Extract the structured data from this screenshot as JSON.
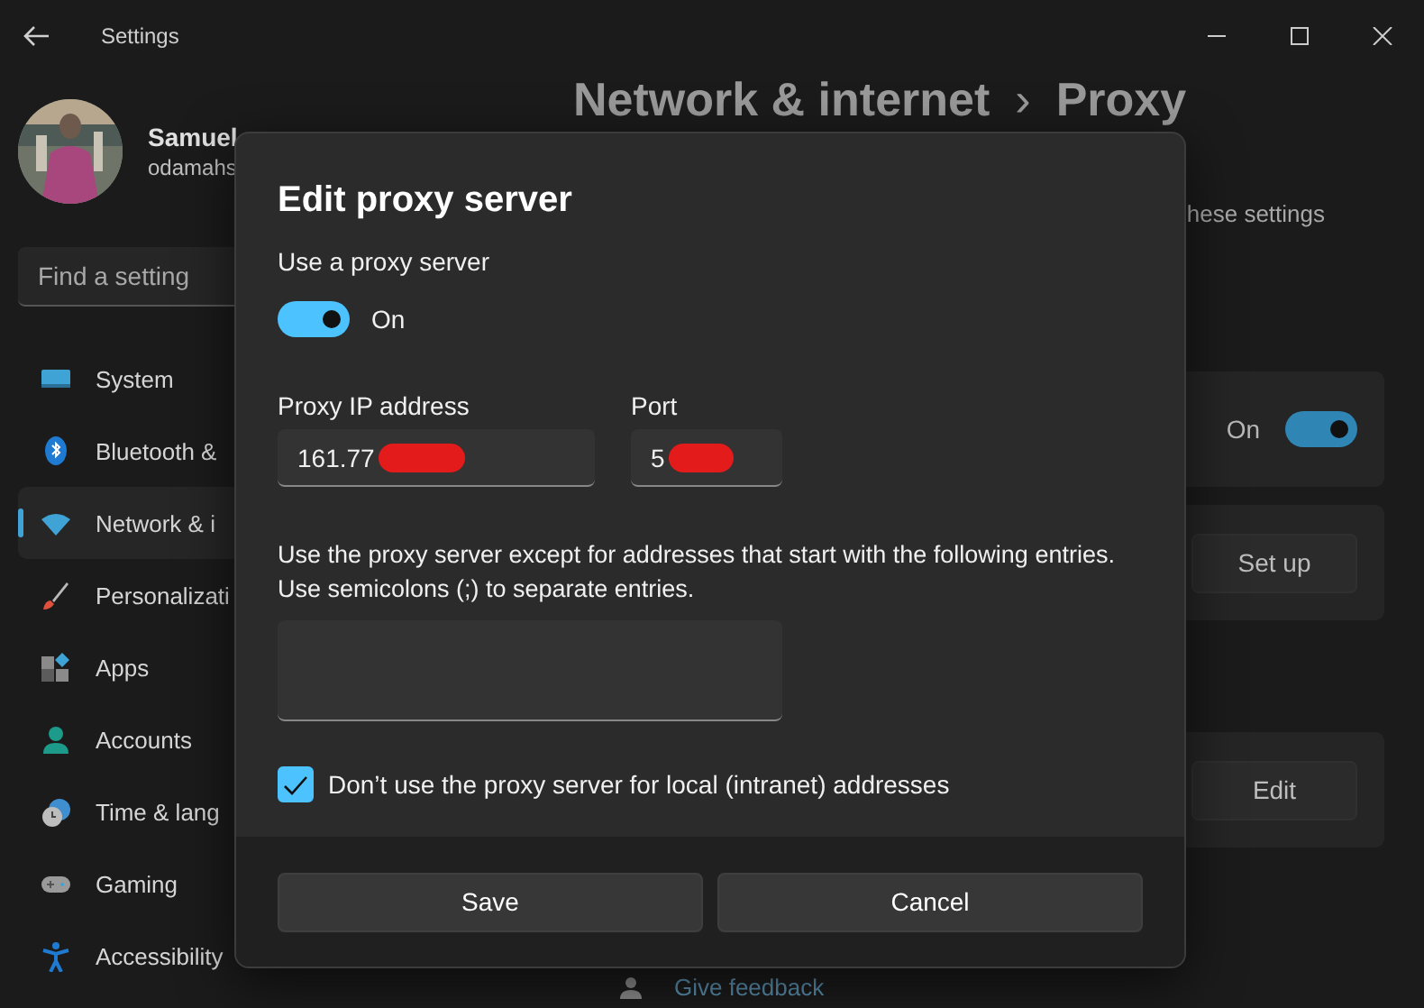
{
  "window": {
    "title": "Settings"
  },
  "profile": {
    "name": "Samuel",
    "email": "odamahs"
  },
  "search": {
    "placeholder": "Find a setting"
  },
  "nav": [
    {
      "label": "System",
      "selected": false
    },
    {
      "label": "Bluetooth &",
      "selected": false
    },
    {
      "label": "Network & i",
      "selected": true
    },
    {
      "label": "Personalizati",
      "selected": false
    },
    {
      "label": "Apps",
      "selected": false
    },
    {
      "label": "Accounts",
      "selected": false
    },
    {
      "label": "Time & lang",
      "selected": false
    },
    {
      "label": "Gaming",
      "selected": false
    },
    {
      "label": "Accessibility",
      "selected": false
    }
  ],
  "page": {
    "breadcrumb": "Network & internet",
    "separator": "›",
    "title": "Proxy",
    "hint": "hese settings"
  },
  "automatic_rows": [
    {
      "kind": "toggle",
      "state_label": "On",
      "on": true
    },
    {
      "kind": "button",
      "button": "Set up"
    }
  ],
  "manual_rows": [
    {
      "kind": "button",
      "button": "Edit"
    }
  ],
  "feedback_link": "Give feedback",
  "dialog": {
    "title": "Edit proxy server",
    "toggle_label": "Use a proxy server",
    "toggle": {
      "on": true,
      "label": "On"
    },
    "ip": {
      "label": "Proxy IP address",
      "value": "161.77",
      "redacted": true
    },
    "port": {
      "label": "Port",
      "value": "5",
      "redacted": true
    },
    "exceptions": {
      "description": "Use the proxy server except for addresses that start with the following entries.\nUse semicolons (;) to separate entries."
    },
    "local_bypass": {
      "label": "Don’t use the proxy server for local (intranet) addresses",
      "checked": true
    },
    "buttons": [
      "Save",
      "Cancel"
    ]
  }
}
